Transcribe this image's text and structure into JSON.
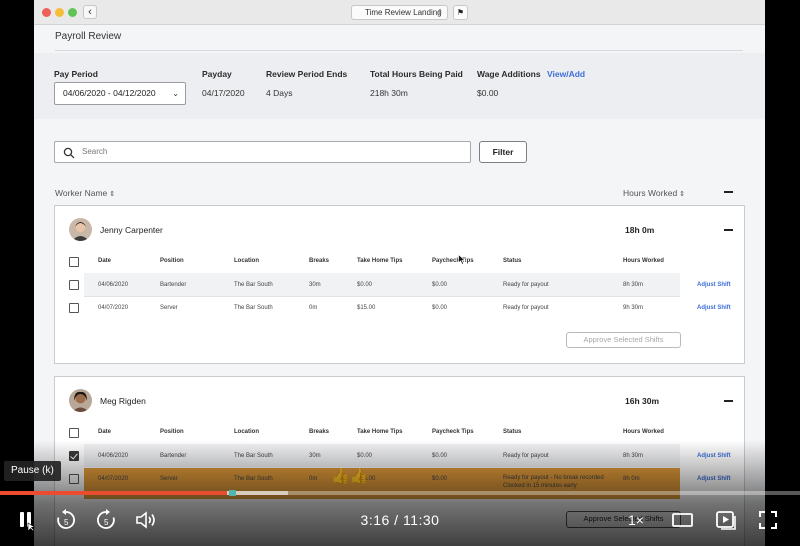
{
  "browser": {
    "page_selector": "Time Review Landing"
  },
  "page": {
    "title": "Payroll Review"
  },
  "summary": {
    "pay_period_label": "Pay Period",
    "pay_period_value": "04/06/2020 - 04/12/2020",
    "payday_label": "Payday",
    "payday_value": "04/17/2020",
    "review_ends_label": "Review Period Ends",
    "review_ends_value": "4 Days",
    "total_hours_label": "Total Hours Being Paid",
    "total_hours_value": "218h 30m",
    "wage_additions_label": "Wage Additions",
    "wage_additions_link": "View/Add",
    "wage_additions_value": "$0.00"
  },
  "search": {
    "placeholder": "Search",
    "filter_label": "Filter"
  },
  "list_header": {
    "worker_name": "Worker Name",
    "hours_worked": "Hours Worked"
  },
  "table_columns": [
    "Date",
    "Position",
    "Location",
    "Breaks",
    "Take Home Tips",
    "Paycheck Tips",
    "Status",
    "Hours Worked"
  ],
  "workers": [
    {
      "name": "Jenny Carpenter",
      "hours": "18h 0m",
      "approve_label": "Approve Selected Shifts",
      "shifts": [
        {
          "date": "04/06/2020",
          "position": "Bartender",
          "location": "The Bar South",
          "breaks": "30m",
          "take_home_tips": "$0.00",
          "paycheck_tips": "$0.00",
          "status": "Ready for payout",
          "status_note": "",
          "hours": "8h 30m",
          "action": "Adjust Shift",
          "checked": false
        },
        {
          "date": "04/07/2020",
          "position": "Server",
          "location": "The Bar South",
          "breaks": "0m",
          "take_home_tips": "$15.00",
          "paycheck_tips": "$0.00",
          "status": "Ready for payout",
          "status_note": "",
          "hours": "9h 30m",
          "action": "Adjust Shift",
          "checked": false
        }
      ]
    },
    {
      "name": "Meg Rigden",
      "hours": "16h 30m",
      "approve_label": "Approve Selected Shifts",
      "shifts": [
        {
          "date": "04/06/2020",
          "position": "Bartender",
          "location": "The Bar South",
          "breaks": "30m",
          "take_home_tips": "$0.00",
          "paycheck_tips": "$0.00",
          "status": "Ready for payout",
          "status_note": "",
          "hours": "8h 30m",
          "action": "Adjust Shift",
          "checked": true
        },
        {
          "date": "04/07/2020",
          "position": "Server",
          "location": "The Bar South",
          "breaks": "0m",
          "take_home_tips": "$15.00",
          "paycheck_tips": "$0.00",
          "status": "Ready for payout - No break recorded",
          "status_note": "Clocked in 15 minutes early",
          "hours": "8h 0m",
          "action": "Adjust Shift",
          "checked": false
        }
      ]
    }
  ],
  "video": {
    "tooltip": "Pause (k)",
    "current_time": "3:16",
    "separator": "/",
    "duration": "11:30",
    "speed": "1×",
    "played_fraction": 0.284,
    "buffered_fraction": 0.36,
    "accent": "#ea4c2f"
  },
  "colors": {
    "link": "#3e6fd8",
    "highlight_row": "#e09a3a"
  }
}
